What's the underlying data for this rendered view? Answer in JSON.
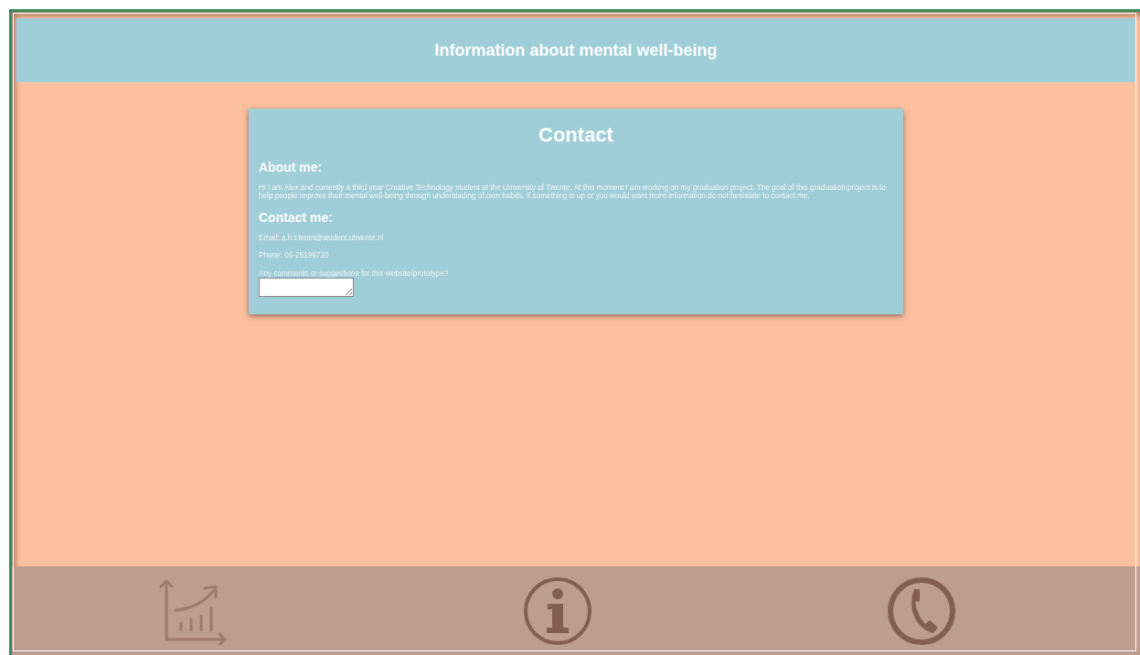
{
  "header": {
    "title": "Information about mental well-being"
  },
  "card": {
    "title": "Contact",
    "about_heading": "About me:",
    "about_text": "Hi I am Alex and currently a third year Creative Technology student at the University of Twente. At this moment I am working on my graduation project. The goal of this graduation project is to help people improve their mental well-being through understading of own habits. If something is up or you would want more information do not hesistate to contact me.",
    "contact_heading": "Contact me:",
    "email": "Email: a.h.t.tenet@student.utwente.nl",
    "phone": "Phone: 06-28199720",
    "comments_label": "Any comments or suggestions for this website/prototype?"
  },
  "nav": [
    {
      "kind": "chart"
    },
    {
      "kind": "info"
    },
    {
      "kind": "phone"
    }
  ]
}
